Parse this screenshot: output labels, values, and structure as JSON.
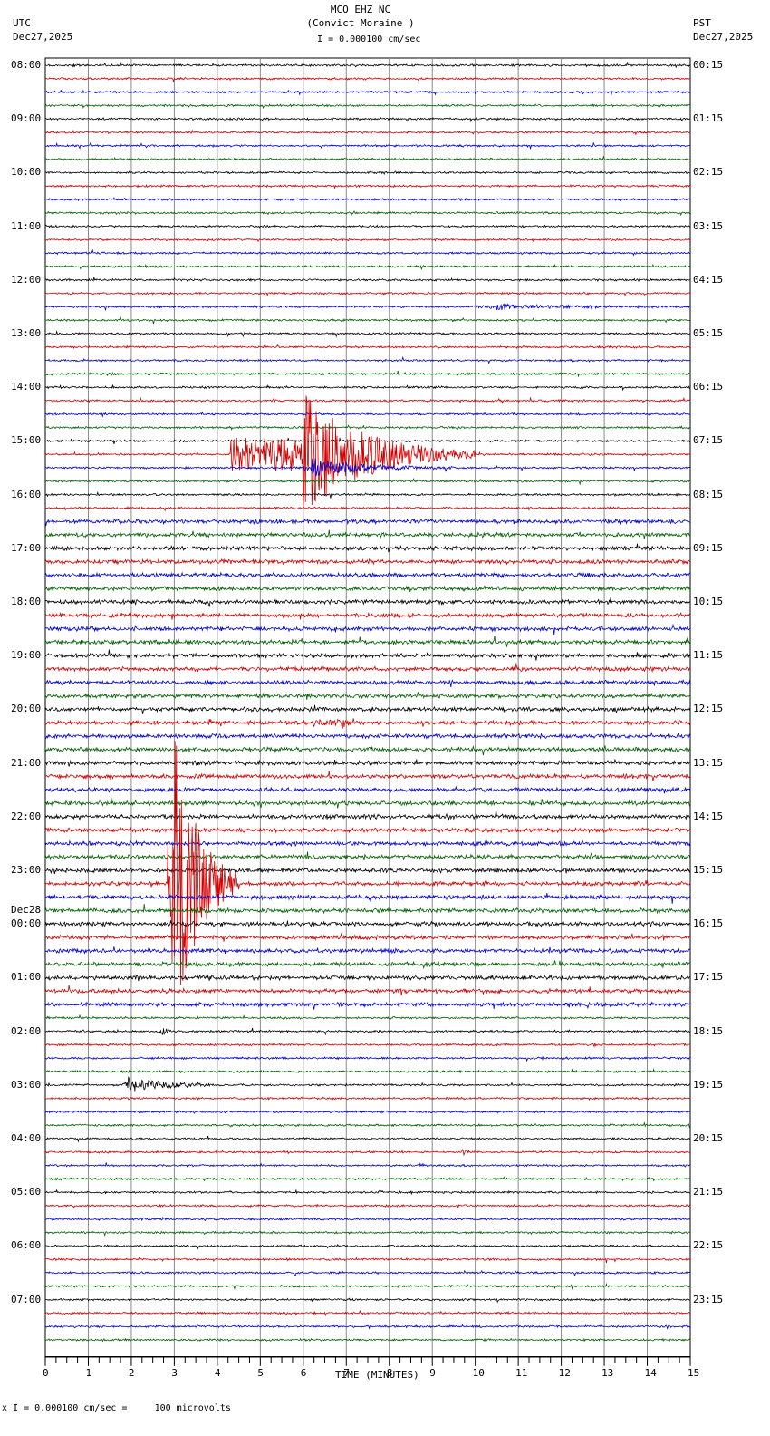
{
  "header": {
    "station": "MCO EHZ NC",
    "location": "(Convict Moraine )",
    "scale": "= 0.000100 cm/sec",
    "left_tz": "UTC",
    "left_date": "Dec27,2025",
    "right_tz": "PST",
    "right_date": "Dec27,2025"
  },
  "footer": {
    "scale_note": "= 0.000100 cm/sec =     100 microvolts"
  },
  "chart_data": {
    "type": "line",
    "title": "MCO EHZ NC (Convict Moraine )",
    "xlabel": "TIME (MINUTES)",
    "xlim": [
      0,
      15
    ],
    "x_ticks": [
      "0",
      "1",
      "2",
      "3",
      "4",
      "5",
      "6",
      "7",
      "8",
      "9",
      "10",
      "11",
      "12",
      "13",
      "14",
      "15"
    ],
    "rows_per_hour": 4,
    "trace_colors": [
      "#000000",
      "#d00000",
      "#0000d0",
      "#006000"
    ],
    "left_labels": [
      "08:00",
      "09:00",
      "10:00",
      "11:00",
      "12:00",
      "13:00",
      "14:00",
      "15:00",
      "16:00",
      "17:00",
      "18:00",
      "19:00",
      "20:00",
      "21:00",
      "22:00",
      "23:00",
      "00:00",
      "01:00",
      "02:00",
      "03:00",
      "04:00",
      "05:00",
      "06:00",
      "07:00"
    ],
    "date_change_label": "Dec28",
    "right_labels": [
      "00:15",
      "01:15",
      "02:15",
      "03:15",
      "04:15",
      "05:15",
      "06:15",
      "07:15",
      "08:15",
      "09:15",
      "10:15",
      "11:15",
      "12:15",
      "13:15",
      "14:15",
      "15:15",
      "16:15",
      "17:15",
      "18:15",
      "19:15",
      "20:15",
      "21:15",
      "22:15",
      "23:15"
    ],
    "events": [
      {
        "row": 29,
        "start_min": 4.3,
        "end_min": 10.0,
        "peak_min": 6.0,
        "amplitude": 70
      },
      {
        "row": 30,
        "start_min": 6.0,
        "end_min": 9.5,
        "peak_min": 6.2,
        "amplitude": 10
      },
      {
        "row": 61,
        "start_min": 2.85,
        "end_min": 4.5,
        "peak_min": 2.95,
        "amplitude": 190
      },
      {
        "row": 49,
        "start_min": 6.2,
        "end_min": 7.2,
        "peak_min": 6.9,
        "amplitude": 6
      },
      {
        "row": 76,
        "start_min": 1.8,
        "end_min": 4.0,
        "peak_min": 1.9,
        "amplitude": 9
      },
      {
        "row": 72,
        "start_min": 2.6,
        "end_min": 3.0,
        "peak_min": 2.7,
        "amplitude": 5
      },
      {
        "row": 81,
        "start_min": 9.7,
        "end_min": 9.85,
        "peak_min": 9.75,
        "amplitude": 9
      },
      {
        "row": 84,
        "start_min": 7.75,
        "end_min": 7.85,
        "peak_min": 7.8,
        "amplitude": 8
      },
      {
        "row": 18,
        "start_min": 10.0,
        "end_min": 14.5,
        "peak_min": 10.5,
        "amplitude": 3
      }
    ]
  }
}
